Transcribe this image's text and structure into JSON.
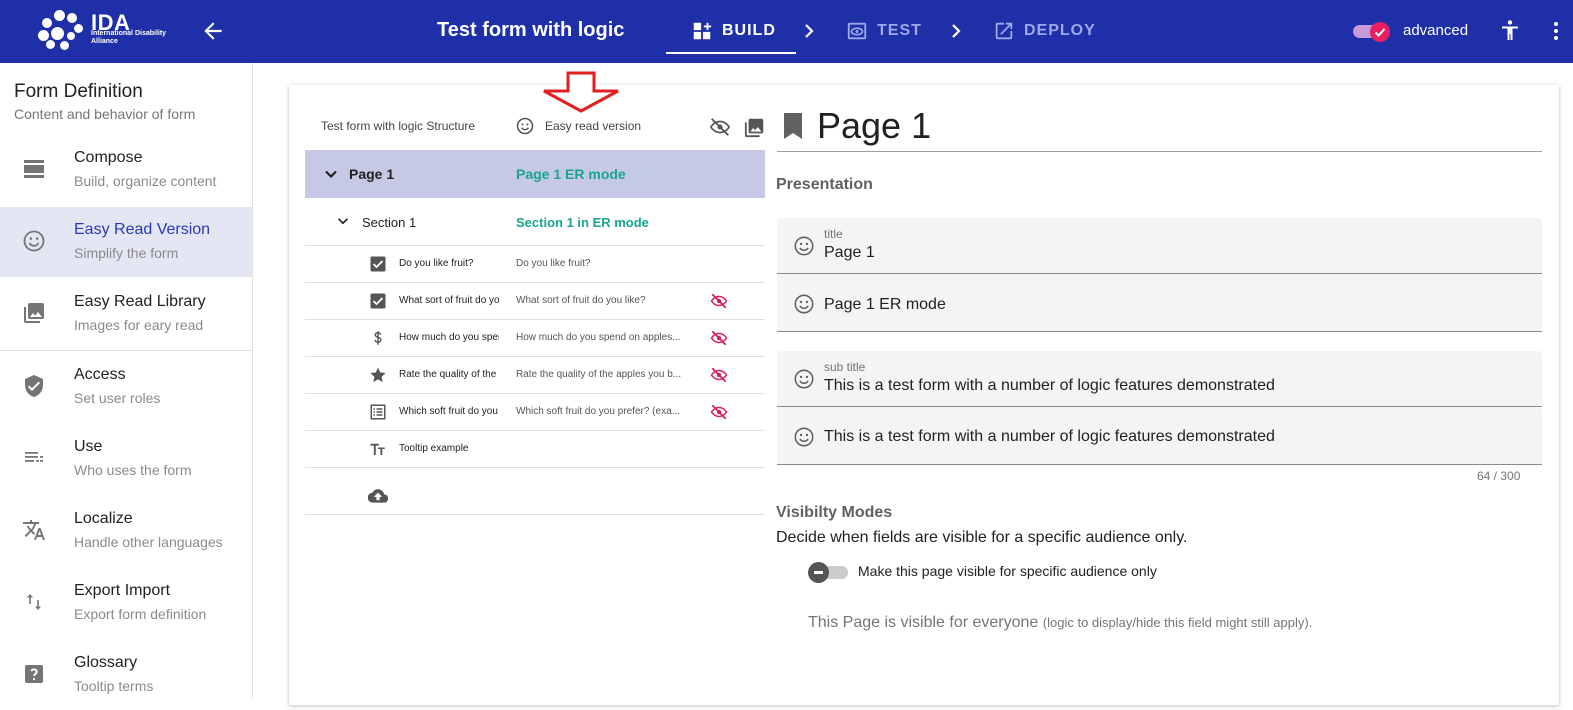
{
  "app": {
    "logo_text": "IDA",
    "logo_subtitle": "International Disability Alliance",
    "form_title": "Test form with logic",
    "nav": [
      {
        "label": "BUILD",
        "icon": "build-grid-icon",
        "active": true
      },
      {
        "label": "TEST",
        "icon": "test-eye-icon",
        "active": false
      },
      {
        "label": "DEPLOY",
        "icon": "deploy-open-icon",
        "active": false
      }
    ],
    "advanced_label": "advanced",
    "advanced_on": true,
    "colors": {
      "bar": "#1e2fa8",
      "accent": "#e91e63",
      "er_text": "#1aa58a",
      "selected_row": "#c5c9e6"
    }
  },
  "sidebar": {
    "title": "Form Definition",
    "subtitle": "Content and behavior of form",
    "items": [
      {
        "label": "Compose",
        "sub": "Build, organize content",
        "icon": "compose-icon"
      },
      {
        "label": "Easy Read Version",
        "sub": "Simplify the form",
        "icon": "smiley-icon",
        "active": true
      },
      {
        "label": "Easy Read Library",
        "sub": "Images for eary read",
        "icon": "image-library-icon"
      },
      {
        "label": "Access",
        "sub": "Set user roles",
        "icon": "shield-icon"
      },
      {
        "label": "Use",
        "sub": "Who uses the form",
        "icon": "list-icon"
      },
      {
        "label": "Localize",
        "sub": "Handle other languages",
        "icon": "translate-icon"
      },
      {
        "label": "Export Import",
        "sub": "Export form definition",
        "icon": "swap-vertical-icon"
      },
      {
        "label": "Glossary",
        "sub": "Tooltip terms",
        "icon": "help-icon"
      }
    ]
  },
  "tree": {
    "header_structure": "Test form with logic Structure",
    "header_easy_read": "Easy read version",
    "page": {
      "label": "Page 1",
      "er": "Page 1 ER mode"
    },
    "section": {
      "label": "Section 1",
      "er": "Section 1 in ER mode"
    },
    "questions": [
      {
        "label": "Do you like fruit?",
        "er": "Do you like fruit?",
        "icon": "checkbox-icon",
        "hidden": false
      },
      {
        "label": "What sort of fruit do you like?",
        "er": "What sort of fruit do you like?",
        "icon": "checkbox-icon",
        "hidden": true
      },
      {
        "label": "How much do you spend on apples?",
        "er": "How much do you spend on apples...",
        "icon": "dollar-icon",
        "hidden": true
      },
      {
        "label": "Rate the quality of the apples",
        "er": "Rate the quality of the apples you b...",
        "icon": "star-icon",
        "hidden": true
      },
      {
        "label": "Which soft fruit do you prefer?",
        "er": "Which soft fruit do you prefer? (exa...",
        "icon": "list-box-icon",
        "hidden": true
      },
      {
        "label": "Tooltip example",
        "er": "",
        "icon": "text-size-icon",
        "hidden": false
      }
    ]
  },
  "panel": {
    "page_title": "Page 1",
    "presentation_label": "Presentation",
    "title_field": {
      "label": "title",
      "value": "Page 1"
    },
    "title_er_field": {
      "value": "Page 1 ER mode"
    },
    "subtitle_field": {
      "label": "sub title",
      "value": "This is a test form with a number of logic features demonstrated"
    },
    "subtitle_er_field": {
      "value": "This is a test form with a number of logic features demonstrated"
    },
    "counter": "64 / 300",
    "visibility_heading": "Visibilty Modes",
    "visibility_desc": "Decide when fields are visible for a specific audience only.",
    "visibility_toggle_label": "Make this page visible for specific audience only",
    "visibility_toggle_on": false,
    "visibility_status": "This Page is visible for everyone",
    "visibility_status_note": "(logic to display/hide this field might still apply)",
    "visibility_status_end": "."
  }
}
